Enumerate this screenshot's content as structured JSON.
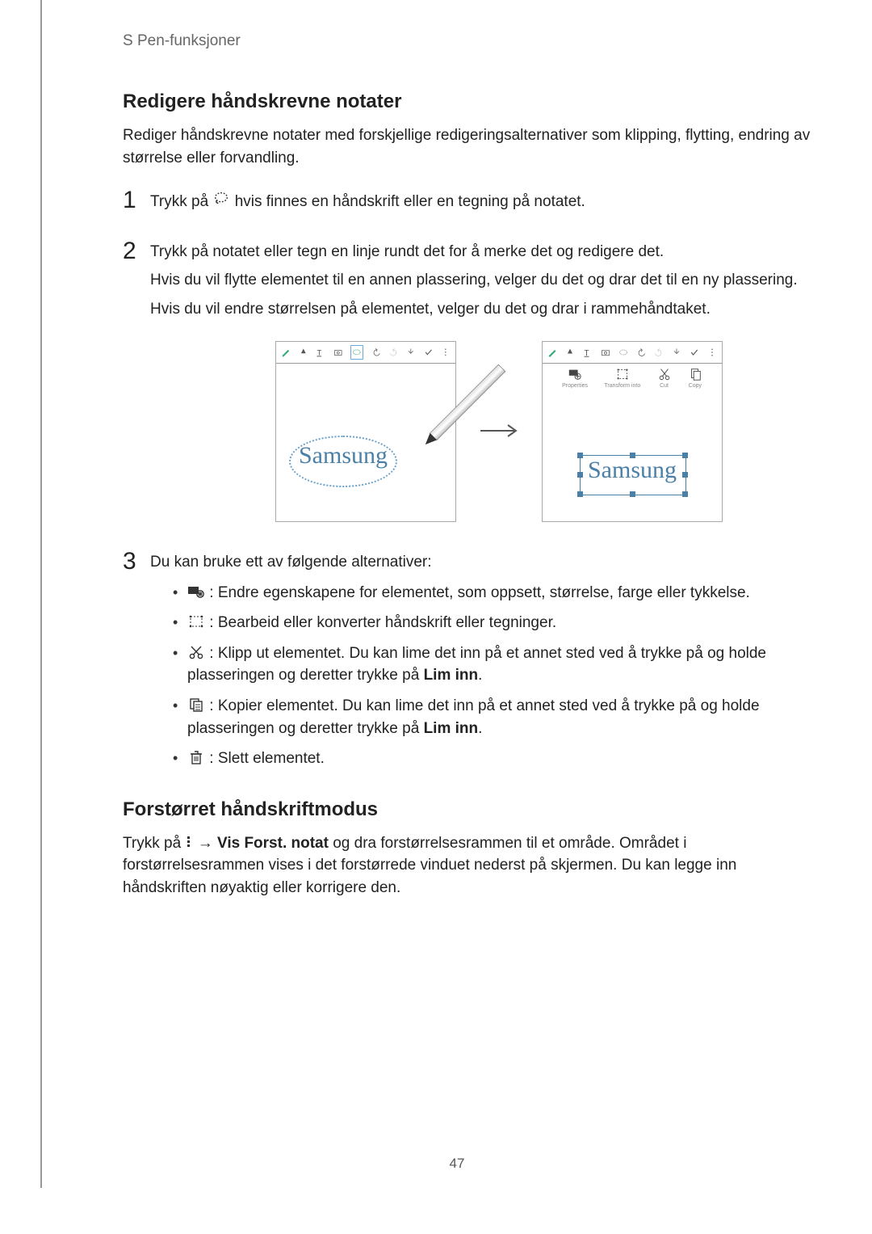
{
  "header": {
    "chapter": "S Pen-funksjoner"
  },
  "section1": {
    "title": "Redigere håndskrevne notater",
    "intro": "Rediger håndskrevne notater med forskjellige redigeringsalternativer som klipping, flytting, endring av størrelse eller forvandling.",
    "steps": [
      {
        "num": "1",
        "text_before": "Trykk på ",
        "text_after": " hvis finnes en håndskrift eller en tegning på notatet."
      },
      {
        "num": "2",
        "text": "Trykk på notatet eller tegn en linje rundt det for å merke det og redigere det.",
        "sub1": "Hvis du vil flytte elementet til en annen plassering, velger du det og drar det til en ny plassering.",
        "sub2": "Hvis du vil endre størrelsen på elementet, velger du det og drar i rammehåndtaket."
      },
      {
        "num": "3",
        "text": "Du kan bruke ett av følgende alternativer:"
      }
    ],
    "options": [
      {
        "text": " : Endre egenskapene for elementet, som oppsett, størrelse, farge eller tykkelse."
      },
      {
        "text": " : Bearbeid eller konverter håndskrift eller tegninger."
      },
      {
        "text_before": " : Klipp ut elementet. Du kan lime det inn på et annet sted ved å trykke på og holde plasseringen og deretter trykke på ",
        "bold": "Lim inn",
        "text_after": "."
      },
      {
        "text_before": " : Kopier elementet. Du kan lime det inn på et annet sted ved å trykke på og holde plasseringen og deretter trykke på ",
        "bold": "Lim inn",
        "text_after": "."
      },
      {
        "text": " : Slett elementet."
      }
    ]
  },
  "illustration": {
    "handwriting": "Samsung",
    "edit_buttons": [
      {
        "label": "Properties"
      },
      {
        "label": "Transform into"
      },
      {
        "label": "Cut"
      },
      {
        "label": "Copy"
      }
    ]
  },
  "section2": {
    "title": "Forstørret håndskriftmodus",
    "text_before": "Trykk på ",
    "arrow": " → ",
    "bold": "Vis Forst. notat",
    "text_after": " og dra forstørrelsesrammen til et område. Området i forstørrelsesrammen vises i det forstørrede vinduet nederst på skjermen. Du kan legge inn håndskriften nøyaktig eller korrigere den."
  },
  "page_number": "47"
}
